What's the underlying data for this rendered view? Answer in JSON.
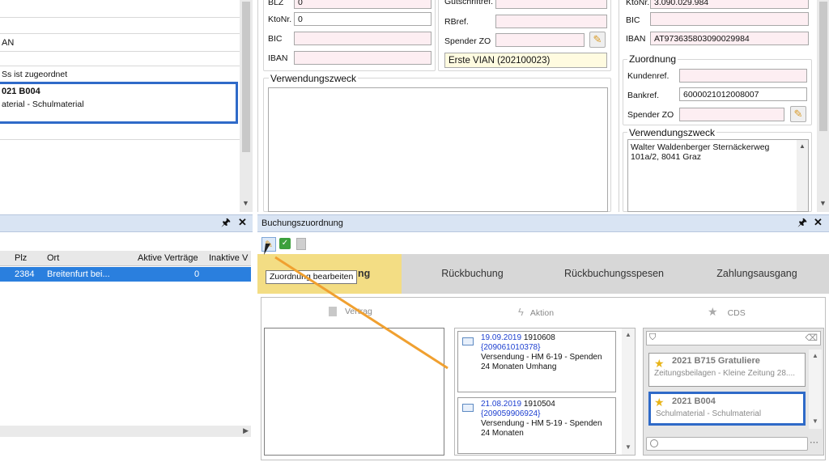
{
  "left_top": {
    "row_an": "AN",
    "assigned_text": "Ss ist zugeordnet",
    "selected_title": "021 B004",
    "selected_sub": "aterial - Schulmaterial"
  },
  "bank_left": {
    "blz_label": "BLZ",
    "blz_value": "0",
    "ktonr_label": "KtoNr.",
    "ktonr_value": "0",
    "bic_label": "BIC",
    "bic_value": "",
    "iban_label": "IBAN",
    "iban_value": ""
  },
  "bank_mid": {
    "gutschrift_label": "Gutschriftref.",
    "rbref_label": "RBref.",
    "spender_label": "Spender ZO",
    "vian_text": "Erste VIAN (202100023)"
  },
  "verwendungszweck_title": "Verwendungszweck",
  "bank_right": {
    "ktonr_label": "KtoNr.",
    "ktonr_value": "3.090.029.984",
    "bic_label": "BIC",
    "bic_value": "",
    "iban_label": "IBAN",
    "iban_value": "AT973635803090029984"
  },
  "zuordnung": {
    "title": "Zuordnung",
    "kundenref_label": "Kundenref.",
    "kundenref_value": "",
    "bankref_label": "Bankref.",
    "bankref_value": "6000021012008007",
    "spender_label": "Spender ZO",
    "spender_value": ""
  },
  "verwendungszweck_right": {
    "title": "Verwendungszweck",
    "text": "Walter Waldenberger Sternäckerweg 101a/2, 8041 Graz"
  },
  "left_list": {
    "columns": [
      "Plz",
      "Ort",
      "Aktive Verträge",
      "Inaktive V"
    ],
    "row": {
      "plz": "2384",
      "ort": "Breitenfurt bei...",
      "aktive": "0",
      "inaktive": ""
    },
    "pin": "🖈",
    "close": "✕"
  },
  "buchung": {
    "title": "Buchungszuordnung",
    "pin": "🖈",
    "close": "✕",
    "tooltip": "Zuordnung bearbeiten",
    "tabs": [
      "ng",
      "Rückbuchung",
      "Rückbuchungsspesen",
      "Zahlungsausgang"
    ],
    "vertrag_label": "Vertrag",
    "aktion_label": "Aktion",
    "cds_label": "CDS"
  },
  "aktion_cards": [
    {
      "date": "19.09.2019",
      "num": "1910608",
      "ref": "{209061010378}",
      "text": "Versendung - HM 6-19 - Spenden 24 Monaten Umhang"
    },
    {
      "date": "21.08.2019",
      "num": "1910504",
      "ref": "{209059906924}",
      "text": "Versendung - HM 5-19 - Spenden 24 Monaten"
    }
  ],
  "cds_items": [
    {
      "title": "2021 B715 Gratuliere",
      "sub": "Zeitungsbeilagen - Kleine Zeitung 28...."
    },
    {
      "title": "2021 B004",
      "sub": "Schulmaterial - Schulmaterial"
    }
  ],
  "colors": {
    "accent": "#f0a030",
    "selected_row": "#2a7fde",
    "highlight_border": "#2f6ac8",
    "tab_active": "#f3dd84",
    "tab_bg": "#d7d7d7"
  }
}
